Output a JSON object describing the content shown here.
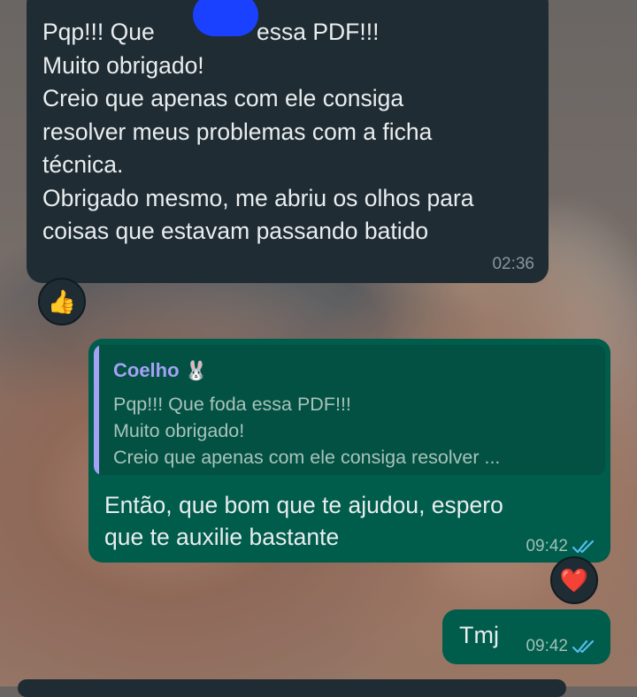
{
  "conversation": {
    "incoming": {
      "text": "Pqp!!! Que\nMuito obrigado!\nCreio que apenas com ele consiga\nresolver meus problemas com a ficha\ntécnica.\nObrigado mesmo, me abriu os olhos para\ncoisas que estavam passando batido",
      "text_line1_end": "essa PDF!!!",
      "time": "02:36",
      "reaction": "👍"
    },
    "reply": {
      "quote_author": "Coelho",
      "quote_author_emoji": "🐰",
      "quote_text": "Pqp!!! Que foda essa PDF!!!\nMuito obrigado!\nCreio que apenas com ele consiga resolver ...",
      "text": "Então, que bom que te ajudou, espero\nque te auxilie bastante",
      "time": "09:42",
      "status_icon": "double-check-read-icon",
      "reaction": "❤️"
    },
    "short": {
      "text": "Tmj",
      "time": "09:42",
      "status_icon": "double-check-read-icon"
    }
  },
  "colors": {
    "incoming_bubble": "#1f2c33",
    "outgoing_bubble": "#005c4b",
    "quote_accent": "#a5a1f5",
    "read_ticks": "#53bdeb"
  }
}
